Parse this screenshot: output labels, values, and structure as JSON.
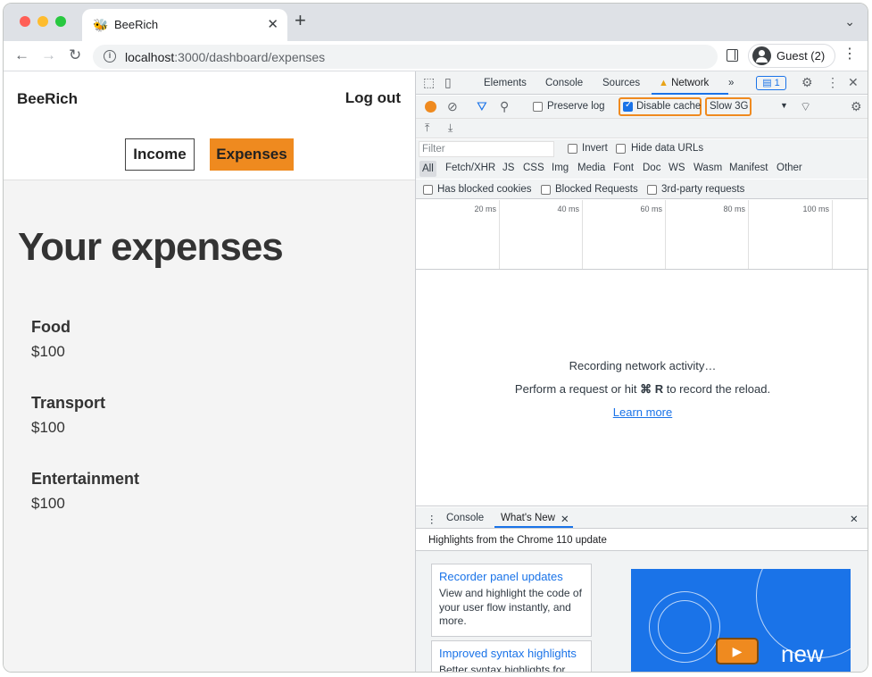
{
  "browser": {
    "tab_title": "BeeRich",
    "tab_favicon": "🐝",
    "url_host": "localhost",
    "url_rest": ":3000/dashboard/expenses",
    "profile_label": "Guest (2)"
  },
  "app": {
    "brand": "BeeRich",
    "logout": "Log out",
    "nav": {
      "income": "Income",
      "expenses": "Expenses"
    },
    "page_title": "Your expenses",
    "expenses": [
      {
        "title": "Food",
        "amount": "$100"
      },
      {
        "title": "Transport",
        "amount": "$100"
      },
      {
        "title": "Entertainment",
        "amount": "$100"
      }
    ]
  },
  "devtools": {
    "tabs": {
      "elements": "Elements",
      "console": "Console",
      "sources": "Sources",
      "network": "Network",
      "more": "»"
    },
    "message_count": "1",
    "preserve_log": "Preserve log",
    "disable_cache": "Disable cache",
    "throttling": "Slow 3G",
    "filter_placeholder": "Filter",
    "invert": "Invert",
    "hide_data_urls": "Hide data URLs",
    "types": [
      "All",
      "Fetch/XHR",
      "JS",
      "CSS",
      "Img",
      "Media",
      "Font",
      "Doc",
      "WS",
      "Wasm",
      "Manifest",
      "Other"
    ],
    "has_blocked_cookies": "Has blocked cookies",
    "blocked_requests": "Blocked Requests",
    "third_party": "3rd-party requests",
    "timeline_ticks": [
      "20 ms",
      "40 ms",
      "60 ms",
      "80 ms",
      "100 ms"
    ],
    "empty_line1": "Recording network activity…",
    "empty_line2_a": "Perform a request or hit ",
    "empty_line2_key": "⌘ R",
    "empty_line2_b": " to record the reload.",
    "learn_more": "Learn more",
    "drawer": {
      "console": "Console",
      "whats_new": "What's New"
    },
    "highlights": "Highlights from the Chrome 110 update",
    "cards": [
      {
        "title": "Recorder panel updates",
        "body": "View and highlight the code of your user flow instantly, and more."
      },
      {
        "title": "Improved syntax highlights",
        "body": "Better syntax highlights for"
      }
    ],
    "promo_text": "new"
  },
  "colors": {
    "accent_orange": "#ef8a1f",
    "devtools_blue": "#1a73e8"
  }
}
